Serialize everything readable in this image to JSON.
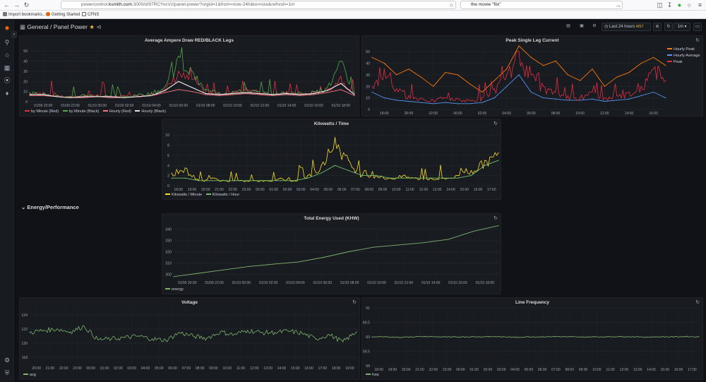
{
  "browser": {
    "url_prefix": "powercontrol.",
    "url_host": "ksmith.com",
    "url_rest": ":3000/d/97RCYvcVz/panel-power?orgId=1&from=now-24h&to=now&refresh=1m",
    "search_text": "the movie \"flix\"",
    "bookmarks": [
      "Import bookmarks...",
      "Getting Started",
      "CFNS"
    ]
  },
  "dashboard": {
    "folder": "General",
    "separator": "/",
    "title": "Panel Power",
    "time_range": "Last 24 hours",
    "timezone": "MST",
    "refresh": "1m",
    "row_title": "Energy/Performance"
  },
  "colors": {
    "red": "#e02f44",
    "green": "#56a64b",
    "pink": "#ff7383",
    "white": "#e0e0e0",
    "orange": "#ff780a",
    "blue": "#5794f2",
    "yellow": "#fade2a",
    "lightgreen": "#73bf69",
    "olive": "#7eb26d"
  },
  "panels": {
    "ampere": {
      "title": "Average Ampere Draw RED/BLACK Legs",
      "y_ticks": [
        "50",
        "40",
        "30",
        "20",
        "10",
        "0"
      ],
      "x_ticks": [
        "01/09 20:00",
        "01/09 22:00",
        "01/10 00:00",
        "01/10 02:00",
        "01/10 04:00",
        "01/10 06:00",
        "01/10 08:00",
        "01/10 10:00",
        "01/10 12:00",
        "01/10 14:00",
        "01/10 16:00",
        "01/10 18:00"
      ],
      "legend": [
        "by Minute (Red)",
        "by Minute (Black)",
        "Hourly (Red)",
        "Hourly (Black)"
      ]
    },
    "peak": {
      "title": "Peak Single Leg Current",
      "y_ticks": [
        "50",
        "40",
        "30",
        "20",
        "10",
        "0"
      ],
      "x_ticks": [
        "18:00",
        "20:00",
        "22:00",
        "00:00",
        "02:00",
        "04:00",
        "06:00",
        "08:00",
        "10:00",
        "12:00",
        "14:00",
        "16:00"
      ],
      "legend": [
        "Hourly Peak",
        "Hourly Average",
        "Peak"
      ]
    },
    "kw": {
      "title": "Kilowatts / Time",
      "y_ticks": [
        "10",
        "8",
        "6",
        "4",
        "2",
        "0"
      ],
      "x_ticks": [
        "18:00",
        "19:00",
        "20:00",
        "21:00",
        "22:00",
        "23:00",
        "00:00",
        "01:00",
        "02:00",
        "03:00",
        "04:00",
        "05:00",
        "06:00",
        "07:00",
        "08:00",
        "09:00",
        "10:00",
        "11:00",
        "12:00",
        "13:00",
        "14:00",
        "15:00",
        "16:00",
        "17:00"
      ],
      "legend": [
        "Kilowatts / Minute",
        "Kilowatts / Hour"
      ]
    },
    "energy": {
      "title": "Total Energy Used (KHW)",
      "y_ticks": [
        "340",
        "330",
        "320",
        "310",
        "300"
      ],
      "x_ticks": [
        "01/09 20:00",
        "01/09 22:00",
        "01/10 00:00",
        "01/10 02:00",
        "01/10 04:00",
        "01/10 06:00",
        "01/10 08:00",
        "01/10 10:00",
        "01/10 12:00",
        "01/10 14:00",
        "01/10 16:00",
        "01/10 18:00"
      ],
      "legend": [
        "energy"
      ]
    },
    "voltage": {
      "title": "Voltage",
      "y_ticks": [
        "124",
        "122",
        "120",
        "118"
      ],
      "x_ticks": [
        "20:00",
        "21:00",
        "22:00",
        "23:00",
        "00:00",
        "01:00",
        "02:00",
        "03:00",
        "04:00",
        "05:00",
        "06:00",
        "07:00",
        "08:00",
        "09:00",
        "10:00",
        "11:00",
        "12:00",
        "13:00",
        "14:00",
        "15:00",
        "16:00",
        "17:00",
        "18:00",
        "19:00"
      ],
      "legend": [
        "avg"
      ]
    },
    "freq": {
      "title": "Line Frequency",
      "y_ticks": [
        "61",
        "60.5",
        "60",
        "59.5",
        "59"
      ],
      "x_ticks": [
        "18:00",
        "19:00",
        "20:00",
        "21:00",
        "22:00",
        "23:00",
        "00:00",
        "01:00",
        "02:00",
        "03:00",
        "04:00",
        "05:00",
        "06:00",
        "07:00",
        "08:00",
        "09:00",
        "10:00",
        "11:00",
        "12:00",
        "13:00",
        "14:00",
        "15:00",
        "16:00",
        "17:00"
      ],
      "legend": [
        "freq"
      ]
    }
  },
  "chart_data": [
    {
      "type": "line",
      "title": "Average Ampere Draw RED/BLACK Legs",
      "x": [
        "01/09 19:00",
        "01/09 20:00",
        "01/09 21:00",
        "01/09 22:00",
        "01/09 23:00",
        "01/10 00:00",
        "01/10 01:00",
        "01/10 02:00",
        "01/10 03:00",
        "01/10 04:00",
        "01/10 05:00",
        "01/10 06:00",
        "01/10 07:00",
        "01/10 08:00",
        "01/10 09:00",
        "01/10 10:00",
        "01/10 11:00",
        "01/10 12:00",
        "01/10 13:00",
        "01/10 14:00",
        "01/10 15:00",
        "01/10 16:00",
        "01/10 17:00",
        "01/10 18:00",
        "01/10 19:00"
      ],
      "ylim": [
        0,
        55
      ],
      "series": [
        {
          "name": "by Minute (Red)",
          "values": [
            8,
            9,
            6,
            5,
            6,
            7,
            5,
            6,
            6,
            8,
            12,
            30,
            22,
            10,
            8,
            9,
            14,
            9,
            7,
            10,
            8,
            9,
            12,
            25,
            8
          ]
        },
        {
          "name": "by Minute (Black)",
          "values": [
            9,
            8,
            6,
            5,
            7,
            6,
            6,
            5,
            7,
            9,
            15,
            45,
            30,
            12,
            9,
            10,
            12,
            10,
            8,
            9,
            9,
            10,
            14,
            40,
            9
          ]
        },
        {
          "name": "Hourly (Red)",
          "values": [
            6,
            6,
            5,
            4,
            4,
            5,
            4,
            4,
            5,
            6,
            9,
            12,
            10,
            7,
            6,
            7,
            8,
            7,
            6,
            7,
            6,
            7,
            9,
            12,
            6
          ]
        },
        {
          "name": "Hourly (Black)",
          "values": [
            7,
            7,
            5,
            4,
            5,
            5,
            5,
            4,
            5,
            6,
            11,
            20,
            14,
            8,
            7,
            8,
            9,
            8,
            7,
            8,
            7,
            8,
            11,
            18,
            7
          ]
        }
      ]
    },
    {
      "type": "line",
      "title": "Peak Single Leg Current",
      "x": [
        "18:00",
        "19:00",
        "20:00",
        "21:00",
        "22:00",
        "23:00",
        "00:00",
        "01:00",
        "02:00",
        "03:00",
        "04:00",
        "05:00",
        "06:00",
        "07:00",
        "08:00",
        "09:00",
        "10:00",
        "11:00",
        "12:00",
        "13:00",
        "14:00",
        "15:00",
        "16:00",
        "17:00",
        "18:00"
      ],
      "ylim": [
        0,
        55
      ],
      "series": [
        {
          "name": "Hourly Peak",
          "values": [
            45,
            40,
            30,
            35,
            28,
            20,
            32,
            30,
            22,
            15,
            25,
            35,
            55,
            45,
            38,
            42,
            30,
            25,
            35,
            20,
            28,
            32,
            40,
            45,
            38
          ]
        },
        {
          "name": "Hourly Average",
          "values": [
            15,
            10,
            8,
            7,
            6,
            5,
            6,
            5,
            5,
            6,
            10,
            20,
            30,
            15,
            10,
            9,
            8,
            8,
            9,
            7,
            8,
            9,
            12,
            15,
            10
          ]
        },
        {
          "name": "Peak",
          "values": [
            20,
            35,
            18,
            12,
            10,
            8,
            10,
            9,
            8,
            10,
            18,
            30,
            50,
            30,
            20,
            15,
            12,
            10,
            15,
            10,
            12,
            15,
            20,
            35,
            25
          ]
        }
      ]
    },
    {
      "type": "line",
      "title": "Kilowatts / Time",
      "x": [
        "18:00",
        "19:00",
        "20:00",
        "21:00",
        "22:00",
        "23:00",
        "00:00",
        "01:00",
        "02:00",
        "03:00",
        "04:00",
        "05:00",
        "06:00",
        "07:00",
        "08:00",
        "09:00",
        "10:00",
        "11:00",
        "12:00",
        "13:00",
        "14:00",
        "15:00",
        "16:00",
        "17:00",
        "18:00"
      ],
      "ylim": [
        0,
        11
      ],
      "series": [
        {
          "name": "Kilowatts / Minute",
          "values": [
            2.5,
            3.5,
            1,
            1.5,
            1,
            1,
            1,
            1,
            1.5,
            1,
            2,
            4,
            9.5,
            5,
            2,
            2,
            1.5,
            2,
            1.5,
            1.5,
            1.5,
            2,
            3,
            5,
            6.5
          ]
        },
        {
          "name": "Kilowatts / Hour",
          "values": [
            1.5,
            1.5,
            1,
            1,
            1,
            1,
            1,
            1,
            1,
            1,
            1.5,
            2.5,
            4,
            3,
            2,
            2,
            1.5,
            1.5,
            1.5,
            1.5,
            1.5,
            1.5,
            2,
            4,
            5
          ]
        }
      ]
    },
    {
      "type": "line",
      "title": "Total Energy Used (KHW)",
      "x": [
        "01/09 19:00",
        "01/09 20:00",
        "01/09 22:00",
        "01/10 00:00",
        "01/10 02:00",
        "01/10 04:00",
        "01/10 06:00",
        "01/10 08:00",
        "01/10 10:00",
        "01/10 12:00",
        "01/10 14:00",
        "01/10 16:00",
        "01/10 18:00",
        "01/10 19:00"
      ],
      "ylim": [
        296,
        344
      ],
      "series": [
        {
          "name": "energy",
          "values": [
            298,
            301,
            304,
            307,
            309,
            311,
            315,
            320,
            324,
            326,
            328,
            331,
            338,
            343
          ]
        }
      ]
    },
    {
      "type": "line",
      "title": "Voltage",
      "x": [
        "19:00",
        "20:00",
        "21:00",
        "22:00",
        "23:00",
        "00:00",
        "01:00",
        "02:00",
        "03:00",
        "04:00",
        "05:00",
        "06:00",
        "07:00",
        "08:00",
        "09:00",
        "10:00",
        "11:00",
        "12:00",
        "13:00",
        "14:00",
        "15:00",
        "16:00",
        "17:00",
        "18:00",
        "19:00"
      ],
      "ylim": [
        117,
        125
      ],
      "series": [
        {
          "name": "avg",
          "values": [
            121.5,
            121.8,
            122,
            121.6,
            122.4,
            120.5,
            120.6,
            120.8,
            121,
            120.6,
            120.4,
            121.5,
            121,
            120.7,
            121.6,
            121.2,
            121.8,
            121.5,
            121.5,
            121.7,
            121.4,
            120.6,
            121.2,
            120.2,
            121.6
          ]
        }
      ]
    },
    {
      "type": "line",
      "title": "Line Frequency",
      "x": [
        "17:00",
        "18:00",
        "19:00",
        "20:00",
        "21:00",
        "22:00",
        "23:00",
        "00:00",
        "01:00",
        "02:00",
        "03:00",
        "04:00",
        "05:00",
        "06:00",
        "07:00",
        "08:00",
        "09:00",
        "10:00",
        "11:00",
        "12:00",
        "13:00",
        "14:00",
        "15:00",
        "16:00",
        "17:00",
        "18:00"
      ],
      "ylim": [
        59,
        61
      ],
      "series": [
        {
          "name": "freq",
          "values": [
            60,
            60,
            59.98,
            60,
            60.01,
            60,
            59.99,
            60,
            60,
            60.01,
            60,
            59.98,
            60,
            60,
            60.01,
            60,
            59.99,
            60,
            60,
            60.01,
            60,
            59.99,
            60,
            60,
            60.01,
            60
          ]
        }
      ]
    }
  ]
}
